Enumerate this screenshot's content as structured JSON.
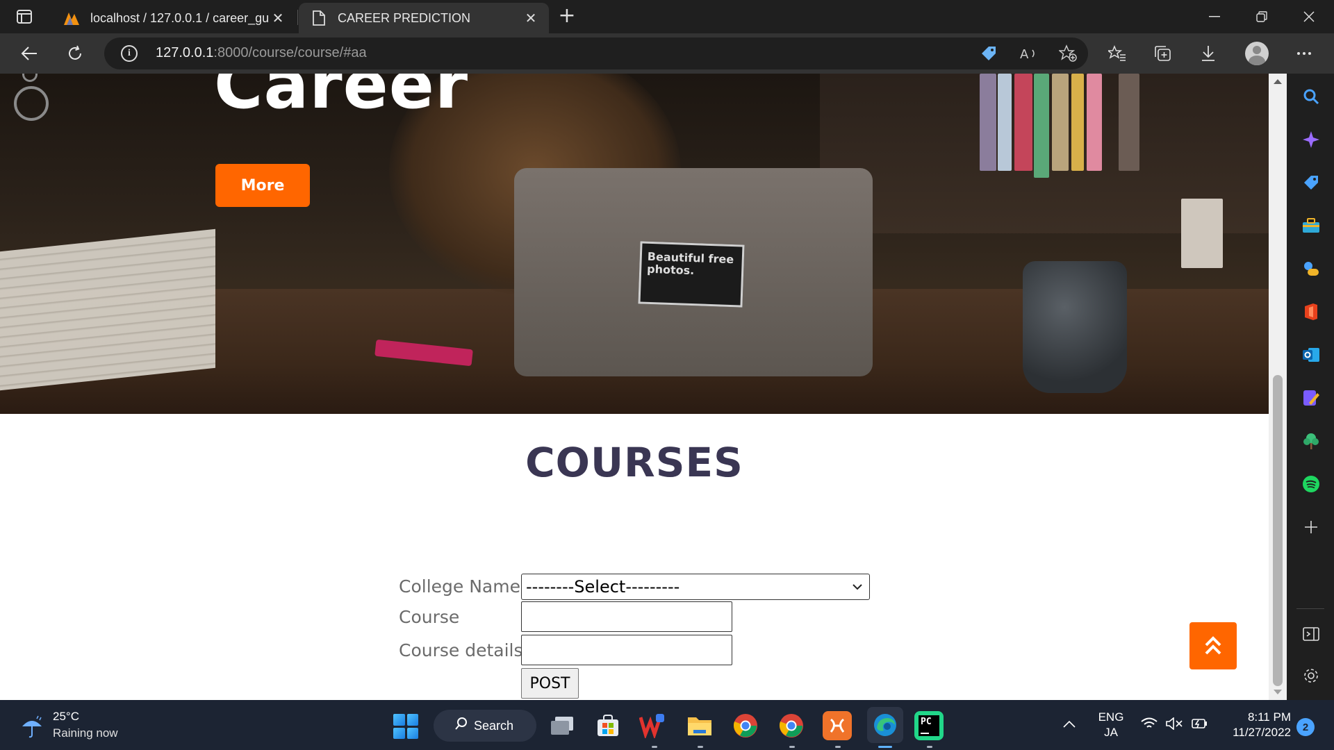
{
  "browser": {
    "tabs": [
      {
        "title": "localhost / 127.0.0.1 / career_gui",
        "favicon": "phpmyadmin-icon",
        "active": false
      },
      {
        "title": "CAREER PREDICTION",
        "favicon": "page-icon",
        "active": true
      }
    ],
    "url": {
      "host": "127.0.0.1",
      "rest": ":8000/course/course/#aa"
    },
    "new_tab_glyph": "+",
    "close_glyph": "✕"
  },
  "hero": {
    "title": "Career",
    "more_button": "More",
    "sticker_text": "Beautiful free photos."
  },
  "courses": {
    "heading": "COURSES",
    "college_label": "College Name",
    "college_select_value": "--------Select---------",
    "course_label": "Course",
    "course_value": "",
    "details_label": "Course details",
    "details_value": "",
    "post_button": "POST"
  },
  "taskbar": {
    "weather_temp": "25°C",
    "weather_desc": "Raining now",
    "search_label": "Search",
    "lang_line1": "ENG",
    "lang_line2": "JA",
    "time": "8:11 PM",
    "date": "11/27/2022",
    "notification_count": "2"
  },
  "colors": {
    "accent_orange": "#ff6600",
    "heading_navy": "#3a3653",
    "chrome_dark": "#1f1f1f",
    "taskbar_bg": "#1c2433"
  }
}
